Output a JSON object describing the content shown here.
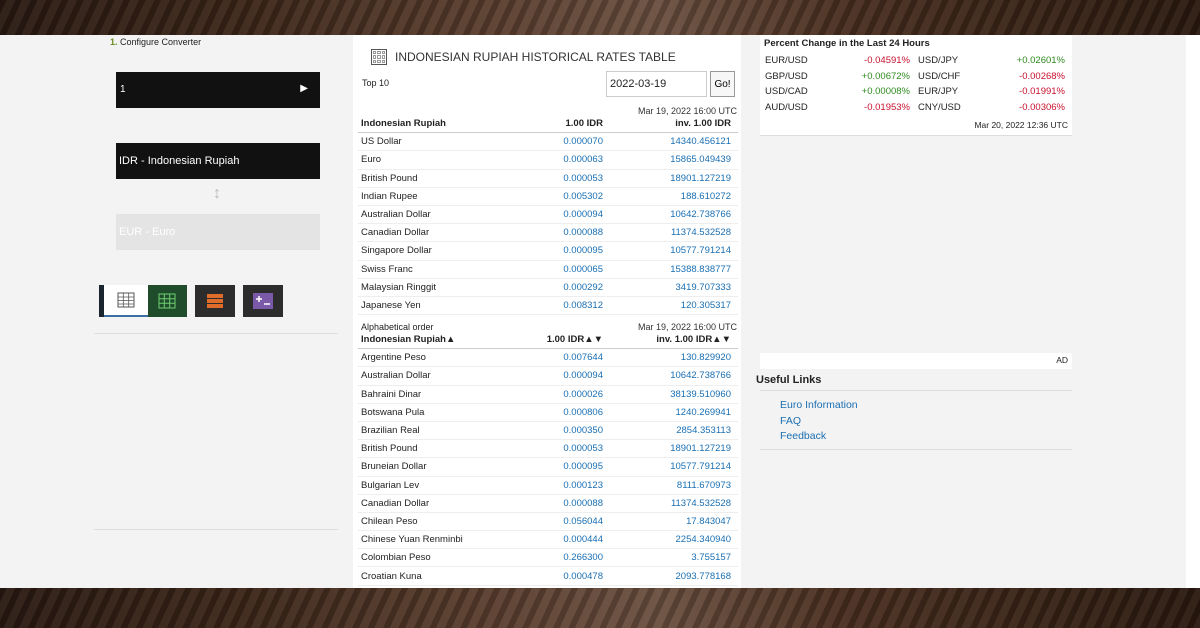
{
  "left": {
    "step_number": "1.",
    "step_label": "Configure Converter",
    "amount": "1",
    "amount_arrow": "▶",
    "from_currency": "IDR - Indonesian Rupiah",
    "swap_icon": "↕",
    "to_currency": "EUR - Euro",
    "tools": [
      "calculator-icon",
      "grid-icon",
      "list-icon",
      "plus-minus-icon",
      "table-icon"
    ]
  },
  "center": {
    "title": "INDONESIAN RUPIAH HISTORICAL RATES TABLE",
    "top10_label": "Top 10",
    "date_value": "2022-03-19",
    "go_label": "Go!",
    "timestamp1": "Mar 19, 2022 16:00 UTC",
    "top_table": {
      "headers": [
        "Indonesian Rupiah",
        "1.00 IDR",
        "inv. 1.00 IDR"
      ],
      "rows": [
        [
          "US Dollar",
          "0.000070",
          "14340.456121"
        ],
        [
          "Euro",
          "0.000063",
          "15865.049439"
        ],
        [
          "British Pound",
          "0.000053",
          "18901.127219"
        ],
        [
          "Indian Rupee",
          "0.005302",
          "188.610272"
        ],
        [
          "Australian Dollar",
          "0.000094",
          "10642.738766"
        ],
        [
          "Canadian Dollar",
          "0.000088",
          "11374.532528"
        ],
        [
          "Singapore Dollar",
          "0.000095",
          "10577.791214"
        ],
        [
          "Swiss Franc",
          "0.000065",
          "15388.838777"
        ],
        [
          "Malaysian Ringgit",
          "0.000292",
          "3419.707333"
        ],
        [
          "Japanese Yen",
          "0.008312",
          "120.305317"
        ]
      ]
    },
    "alpha_label": "Alphabetical order",
    "timestamp2": "Mar 19, 2022 16:00 UTC",
    "alpha_table": {
      "headers": [
        "Indonesian Rupiah▲",
        "1.00 IDR▲▼",
        "inv. 1.00 IDR▲▼"
      ],
      "rows": [
        [
          "Argentine Peso",
          "0.007644",
          "130.829920"
        ],
        [
          "Australian Dollar",
          "0.000094",
          "10642.738766"
        ],
        [
          "Bahraini Dinar",
          "0.000026",
          "38139.510960"
        ],
        [
          "Botswana Pula",
          "0.000806",
          "1240.269941"
        ],
        [
          "Brazilian Real",
          "0.000350",
          "2854.353113"
        ],
        [
          "British Pound",
          "0.000053",
          "18901.127219"
        ],
        [
          "Bruneian Dollar",
          "0.000095",
          "10577.791214"
        ],
        [
          "Bulgarian Lev",
          "0.000123",
          "8111.670973"
        ],
        [
          "Canadian Dollar",
          "0.000088",
          "11374.532528"
        ],
        [
          "Chilean Peso",
          "0.056044",
          "17.843047"
        ],
        [
          "Chinese Yuan Renminbi",
          "0.000444",
          "2254.340940"
        ],
        [
          "Colombian Peso",
          "0.266300",
          "3.755157"
        ],
        [
          "Croatian Kuna",
          "0.000478",
          "2093.778168"
        ]
      ]
    }
  },
  "right": {
    "pc_title": "Percent Change in the Last 24 Hours",
    "pc_rows": [
      {
        "pair1": "EUR/USD",
        "val1": "-0.04591%",
        "pair2": "USD/JPY",
        "val2": "+0.02601%"
      },
      {
        "pair1": "GBP/USD",
        "val1": "+0.00672%",
        "pair2": "USD/CHF",
        "val2": "-0.00268%"
      },
      {
        "pair1": "USD/CAD",
        "val1": "+0.00008%",
        "pair2": "EUR/JPY",
        "val2": "-0.01991%"
      },
      {
        "pair1": "AUD/USD",
        "val1": "-0.01953%",
        "pair2": "CNY/USD",
        "val2": "-0.00306%"
      }
    ],
    "pc_date": "Mar 20, 2022 12:36 UTC",
    "ad_label": "AD",
    "useful_title": "Useful Links",
    "links": [
      "Euro Information",
      "FAQ",
      "Feedback"
    ],
    "colors": {
      "negative": "#c8102e",
      "positive": "#2f8a1f",
      "link": "#1a6fb3"
    }
  }
}
